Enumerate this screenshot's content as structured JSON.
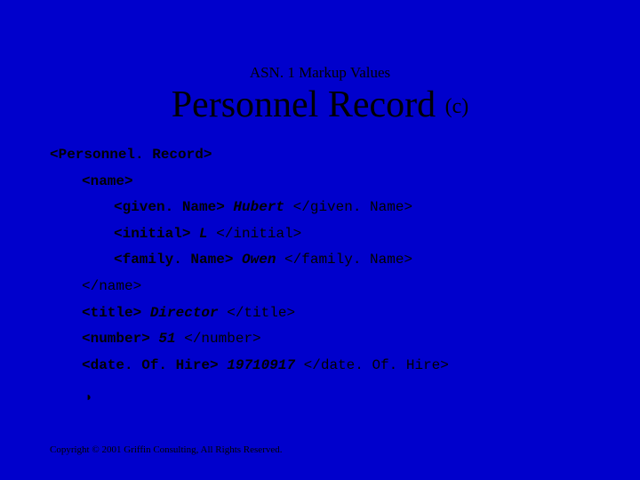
{
  "pretitle": "ASN. 1 Markup Values",
  "title_main": "Personnel Record ",
  "title_suffix": "(c)",
  "tags": {
    "personnelRecord_open": "<Personnel. Record>",
    "name_open": "<name>",
    "givenName_open": "<given. Name> ",
    "givenName_close": " </given. Name>",
    "initial_open": "<initial> ",
    "initial_close": " </initial>",
    "familyName_open": "<family. Name> ",
    "familyName_close": " </family. Name>",
    "name_close": "</name>",
    "title_open": "<title> ",
    "title_close": " </title>",
    "number_open": "<number> ",
    "number_close": " </number>",
    "dateOfHire_open": "<date. Of. Hire> ",
    "dateOfHire_close": " </date. Of. Hire>"
  },
  "values": {
    "givenName": "Hubert",
    "initial": "L",
    "familyName": "Owen",
    "title": "Director",
    "number": "51",
    "dateOfHire": "19710917"
  },
  "bullet_glyph": "◗",
  "copyright": "Copyright © 2001 Griffin Consulting, All Rights Reserved."
}
